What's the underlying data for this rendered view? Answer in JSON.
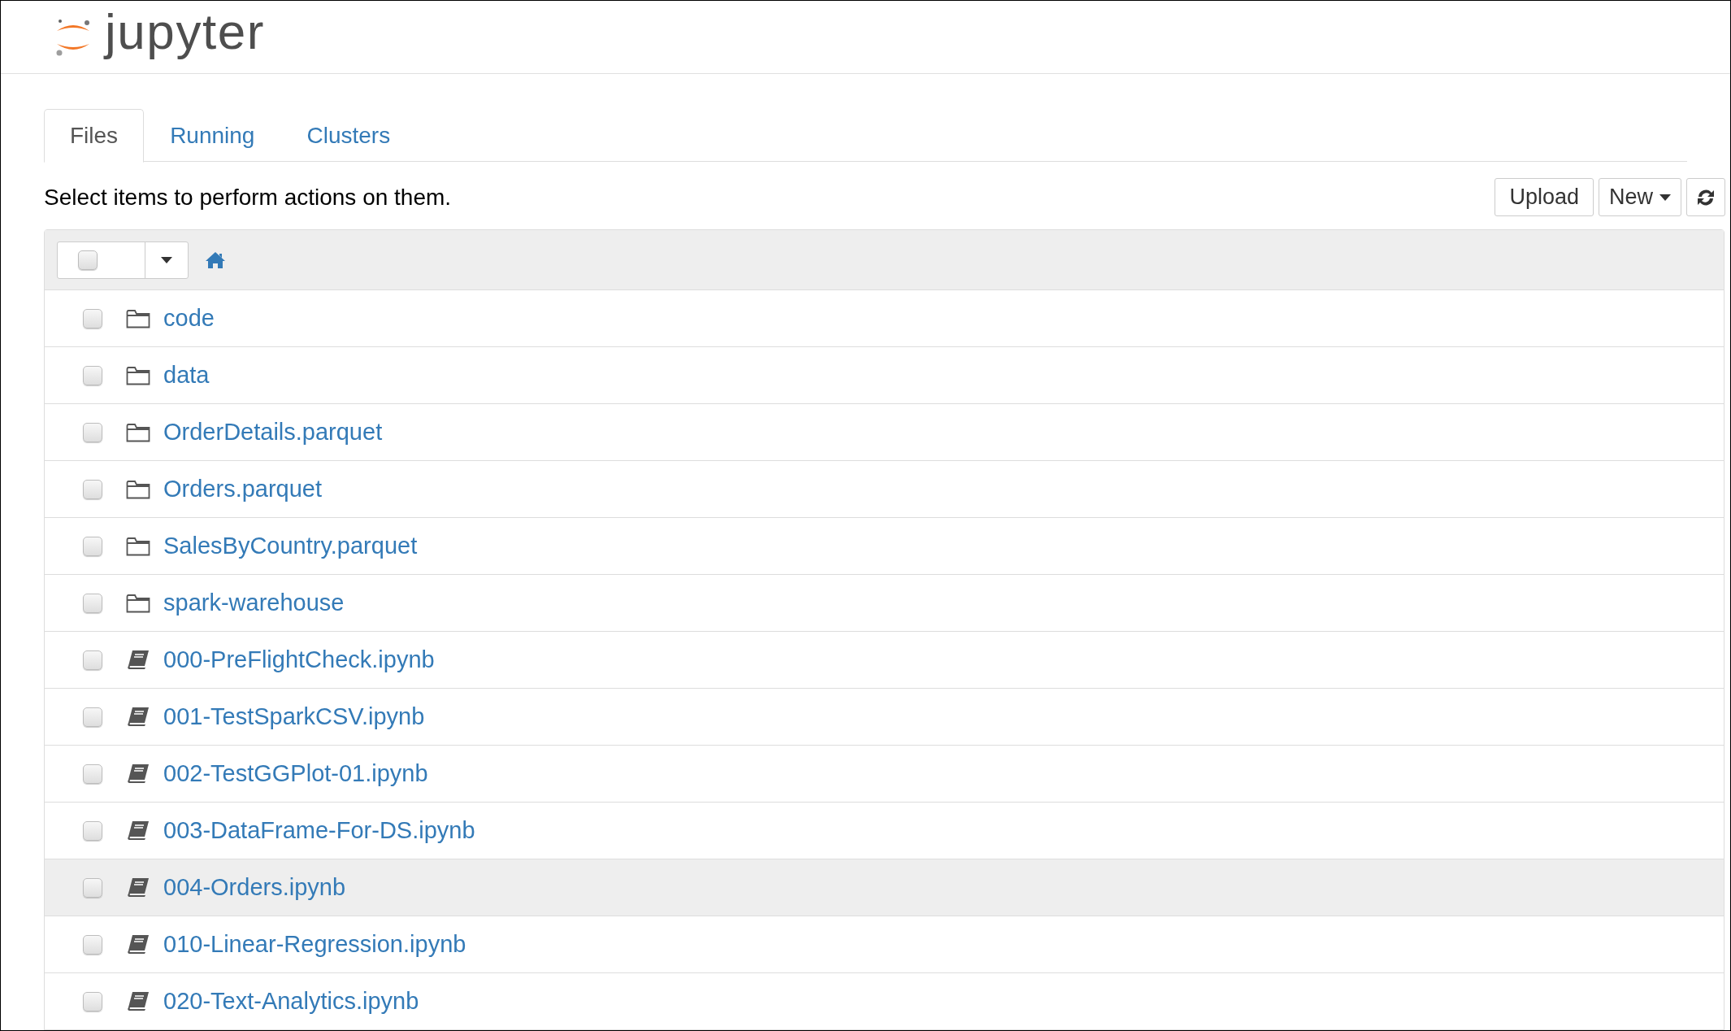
{
  "header": {
    "logo_text": "jupyter"
  },
  "tabs": [
    {
      "label": "Files",
      "selected": true
    },
    {
      "label": "Running",
      "selected": false
    },
    {
      "label": "Clusters",
      "selected": false
    }
  ],
  "toolbar": {
    "instruction": "Select items to perform actions on them.",
    "buttons": [
      {
        "kind": "text",
        "label": "Upload"
      },
      {
        "kind": "dropdown",
        "label": "New"
      },
      {
        "kind": "refresh"
      }
    ]
  },
  "list_header": {
    "select_all_checked": false
  },
  "items": [
    {
      "kind": "folder",
      "name": "code",
      "checked": false,
      "highlighted": false
    },
    {
      "kind": "folder",
      "name": "data",
      "checked": false,
      "highlighted": false
    },
    {
      "kind": "folder",
      "name": "OrderDetails.parquet",
      "checked": false,
      "highlighted": false
    },
    {
      "kind": "folder",
      "name": "Orders.parquet",
      "checked": false,
      "highlighted": false
    },
    {
      "kind": "folder",
      "name": "SalesByCountry.parquet",
      "checked": false,
      "highlighted": false
    },
    {
      "kind": "folder",
      "name": "spark-warehouse",
      "checked": false,
      "highlighted": false
    },
    {
      "kind": "notebook",
      "name": "000-PreFlightCheck.ipynb",
      "checked": false,
      "highlighted": false
    },
    {
      "kind": "notebook",
      "name": "001-TestSparkCSV.ipynb",
      "checked": false,
      "highlighted": false
    },
    {
      "kind": "notebook",
      "name": "002-TestGGPlot-01.ipynb",
      "checked": false,
      "highlighted": false
    },
    {
      "kind": "notebook",
      "name": "003-DataFrame-For-DS.ipynb",
      "checked": false,
      "highlighted": false
    },
    {
      "kind": "notebook",
      "name": "004-Orders.ipynb",
      "checked": false,
      "highlighted": true
    },
    {
      "kind": "notebook",
      "name": "010-Linear-Regression.ipynb",
      "checked": false,
      "highlighted": false
    },
    {
      "kind": "notebook",
      "name": "020-Text-Analytics.ipynb",
      "checked": false,
      "highlighted": false
    }
  ]
}
